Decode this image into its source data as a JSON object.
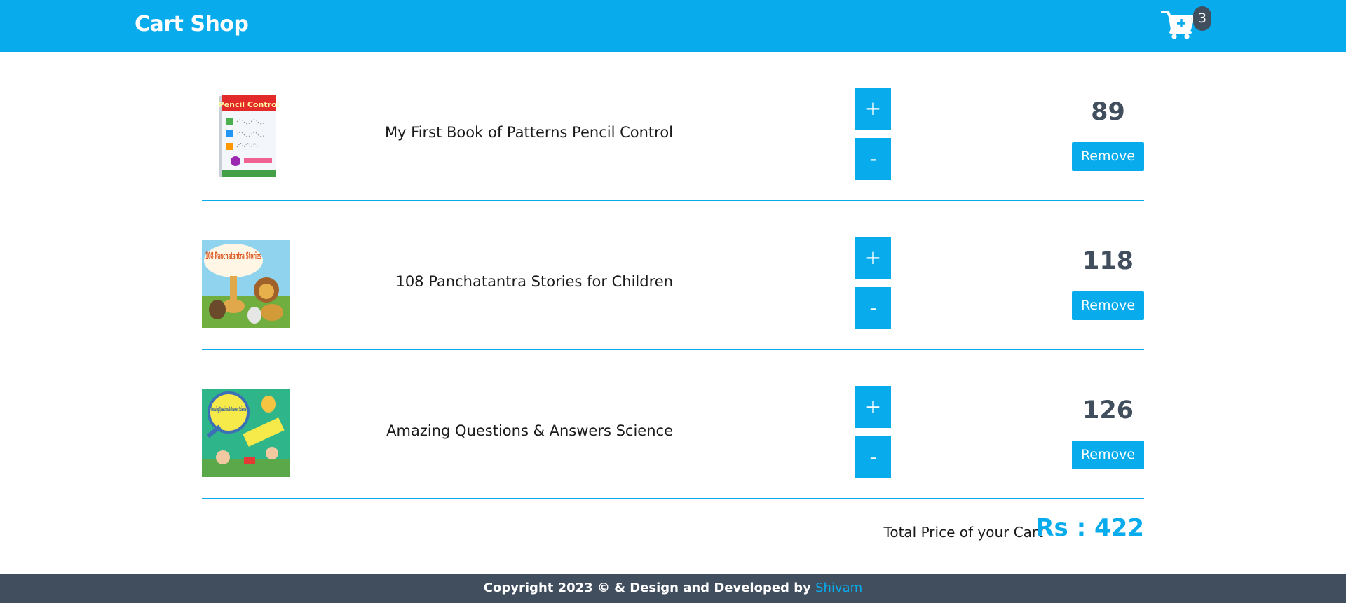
{
  "header": {
    "brand": "Cart Shop",
    "cart_icon": "cart-plus-icon",
    "cart_count": "3"
  },
  "cart": {
    "items": [
      {
        "title": "My First Book of Patterns Pencil Control",
        "price": "89",
        "plus_label": "+",
        "minus_label": "-",
        "remove_label": "Remove",
        "cover_text": "Pencil Control"
      },
      {
        "title": "108 Panchatantra Stories for Children",
        "price": "118",
        "plus_label": "+",
        "minus_label": "-",
        "remove_label": "Remove",
        "cover_text": "108 Panchatantra Stories"
      },
      {
        "title": "Amazing Questions & Answers Science",
        "price": "126",
        "plus_label": "+",
        "minus_label": "-",
        "remove_label": "Remove",
        "cover_text": "Amazing Questions & Answers Science"
      }
    ]
  },
  "total": {
    "label": "Total Price of your Cart",
    "value": "Rs : 422"
  },
  "footer": {
    "text": "Copyright 2023 © & Design and Developed by",
    "author": "Shivam"
  },
  "colors": {
    "primary": "#08aced",
    "dark": "#414e5e"
  }
}
